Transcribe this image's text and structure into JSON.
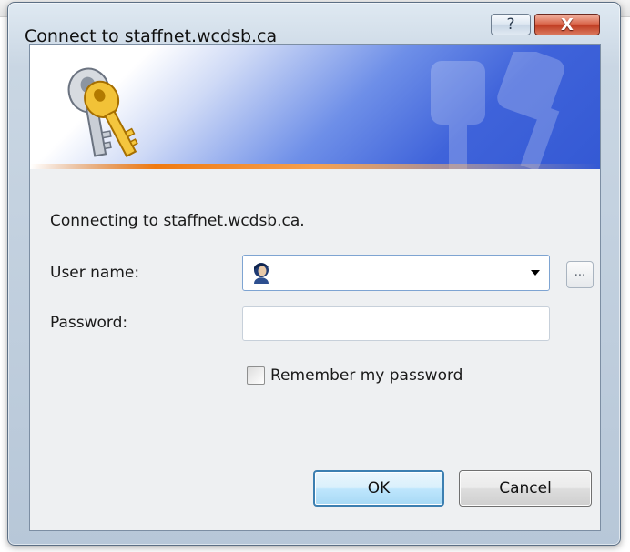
{
  "dialog": {
    "title": "Connect to staffnet.wcdsb.ca",
    "help_glyph": "?",
    "close_glyph": "X",
    "banner_icon": "keys-icon",
    "message": "Connecting to staffnet.wcdsb.ca."
  },
  "form": {
    "username_label": "User name:",
    "username_value": "",
    "username_icon": "user-icon",
    "browse_label": "...",
    "password_label": "Password:",
    "password_value": "",
    "remember_label": "Remember my password",
    "remember_checked": false
  },
  "buttons": {
    "ok_label": "OK",
    "cancel_label": "Cancel"
  },
  "colors": {
    "banner_blue": "#3459d4",
    "accent_orange": "#f07a10",
    "close_red": "#c4432a",
    "ok_border": "#3c7fb1"
  }
}
